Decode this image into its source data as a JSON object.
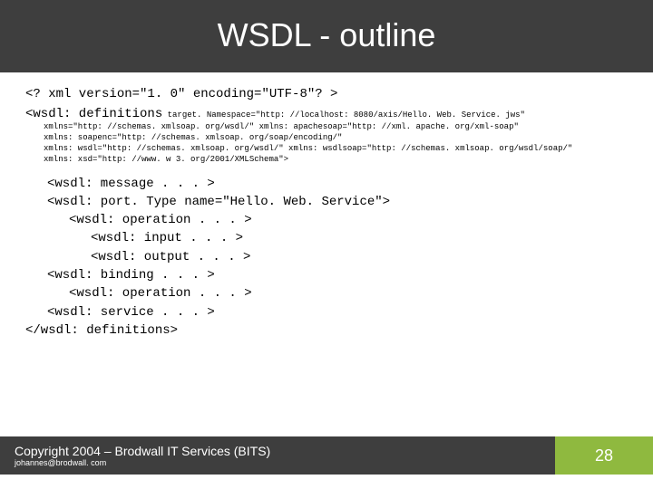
{
  "title": "WSDL - outline",
  "xml_decl": "<? xml version=\"1. 0\" encoding=\"UTF-8\"? >",
  "defs_open": "<wsdl: definitions",
  "defs_attr_first": " target. Namespace=\"http: //localhost: 8080/axis/Hello. Web. Service. jws\"",
  "defs_attrs": [
    "xmlns=\"http: //schemas. xmlsoap. org/wsdl/\" xmlns: apachesoap=\"http: //xml. apache. org/xml-soap\"",
    "xmlns: soapenc=\"http: //schemas. xmlsoap. org/soap/encoding/\"",
    "xmlns: wsdl=\"http: //schemas. xmlsoap. org/wsdl/\" xmlns: wsdlsoap=\"http: //schemas. xmlsoap. org/wsdl/soap/\"",
    "xmlns: xsd=\"http: //www. w 3. org/2001/XMLSchema\">"
  ],
  "lines": [
    {
      "indent": "ind1",
      "text": "<wsdl: message . . . >"
    },
    {
      "indent": "ind1",
      "text": "<wsdl: port. Type name=\"Hello. Web. Service\">"
    },
    {
      "indent": "ind2",
      "text": "<wsdl: operation . . . >"
    },
    {
      "indent": "ind3",
      "text": "<wsdl: input . . . >"
    },
    {
      "indent": "ind3",
      "text": "<wsdl: output . . . >"
    },
    {
      "indent": "ind1",
      "text": "<wsdl: binding . . . >"
    },
    {
      "indent": "ind2",
      "text": "<wsdl: operation . . . >"
    },
    {
      "indent": "ind1",
      "text": "<wsdl: service . . . >"
    },
    {
      "indent": "",
      "text": "</wsdl: definitions>"
    }
  ],
  "footer": {
    "copyright": "Copyright 2004 – Brodwall IT Services (BITS)",
    "email": "johannes@brodwall. com",
    "page": "28"
  }
}
